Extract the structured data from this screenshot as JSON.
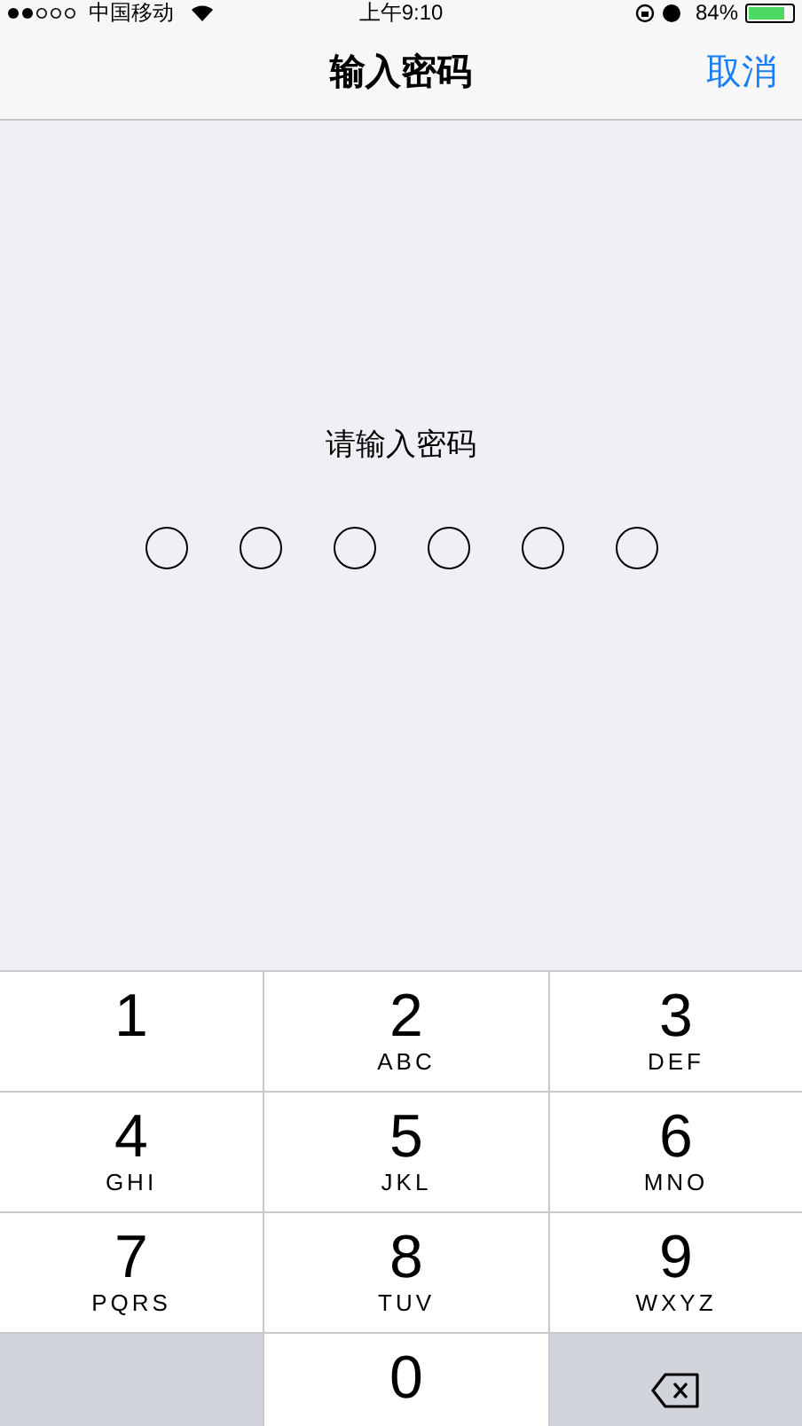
{
  "status_bar": {
    "carrier": "中国移动",
    "time": "上午9:10",
    "battery": "84%"
  },
  "nav": {
    "title": "输入密码",
    "cancel": "取消"
  },
  "prompt": "请输入密码",
  "passcode": [
    {
      "filled": false
    },
    {
      "filled": false
    },
    {
      "filled": false
    },
    {
      "filled": false
    },
    {
      "filled": false
    },
    {
      "filled": false
    }
  ],
  "keys": [
    {
      "kind": "digit",
      "digit": "1"
    },
    {
      "kind": "digit",
      "digit": "2",
      "letters": "ABC"
    },
    {
      "kind": "digit",
      "digit": "3",
      "letters": "DEF"
    },
    {
      "kind": "digit",
      "digit": "4",
      "letters": "GHI"
    },
    {
      "kind": "digit",
      "digit": "5",
      "letters": "JKL"
    },
    {
      "kind": "digit",
      "digit": "6",
      "letters": "MNO"
    },
    {
      "kind": "digit",
      "digit": "7",
      "letters": "PQRS"
    },
    {
      "kind": "digit",
      "digit": "8",
      "letters": "TUV"
    },
    {
      "kind": "digit",
      "digit": "9",
      "letters": "WXYZ"
    },
    {
      "kind": "blank"
    },
    {
      "kind": "digit",
      "digit": "0"
    },
    {
      "kind": "delete"
    }
  ]
}
